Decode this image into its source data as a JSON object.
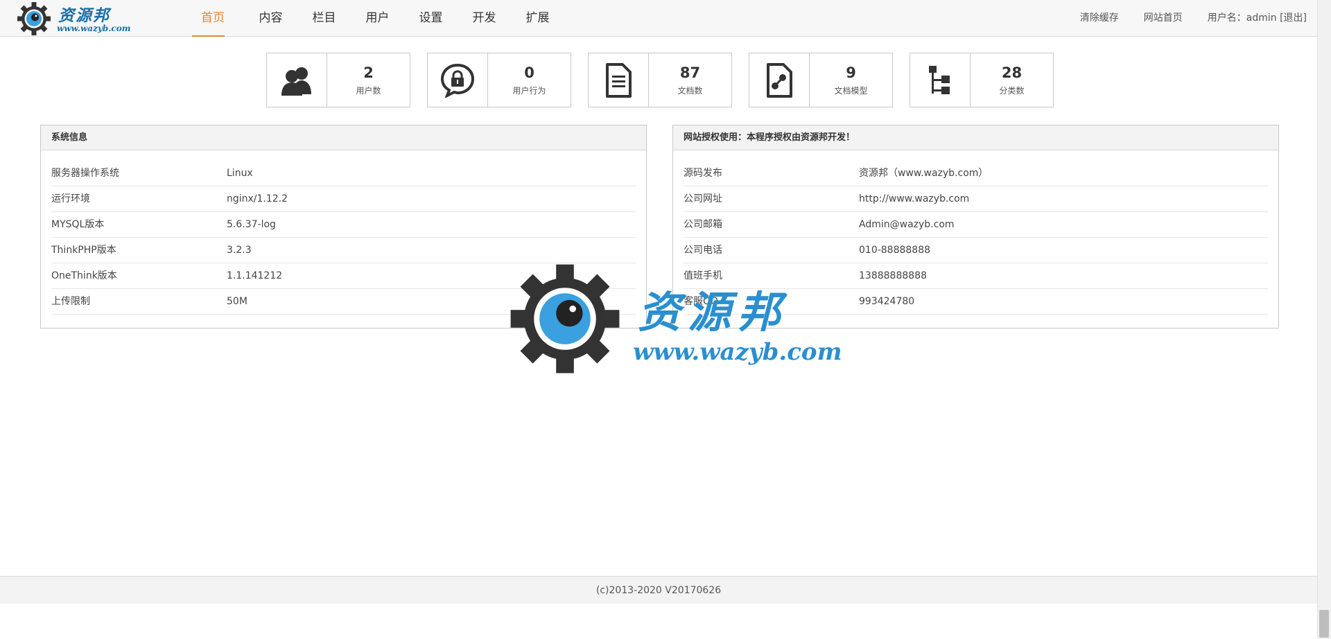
{
  "header": {
    "logo": {
      "title": "资源邦",
      "url": "www.wazyb.com"
    },
    "nav": [
      {
        "label": "首页",
        "active": true
      },
      {
        "label": "内容"
      },
      {
        "label": "栏目"
      },
      {
        "label": "用户"
      },
      {
        "label": "设置"
      },
      {
        "label": "开发"
      },
      {
        "label": "扩展"
      }
    ],
    "right": {
      "clear_cache": "清除缓存",
      "site_home": "网站首页",
      "user_prefix": "用户名：admin",
      "logout": "[退出]"
    }
  },
  "stats": [
    {
      "icon": "users-icon",
      "value": "2",
      "label": "用户数"
    },
    {
      "icon": "lock-chat-icon",
      "value": "0",
      "label": "用户行为"
    },
    {
      "icon": "document-icon",
      "value": "87",
      "label": "文档数"
    },
    {
      "icon": "document-model-icon",
      "value": "9",
      "label": "文档模型"
    },
    {
      "icon": "tree-icon",
      "value": "28",
      "label": "分类数"
    }
  ],
  "system_panel": {
    "title": "系统信息",
    "rows": [
      {
        "k": "服务器操作系统",
        "v": "Linux"
      },
      {
        "k": "运行环境",
        "v": "nginx/1.12.2"
      },
      {
        "k": "MYSQL版本",
        "v": "5.6.37-log"
      },
      {
        "k": "ThinkPHP版本",
        "v": "3.2.3"
      },
      {
        "k": "OneThink版本",
        "v": "1.1.141212"
      },
      {
        "k": "上传限制",
        "v": "50M"
      }
    ]
  },
  "license_panel": {
    "title": "网站授权使用：本程序授权由资源邦开发！",
    "rows": [
      {
        "k": "源码发布",
        "v": "资源邦（www.wazyb.com）"
      },
      {
        "k": "公司网址",
        "v": "http://www.wazyb.com"
      },
      {
        "k": "公司邮箱",
        "v": "Admin@wazyb.com"
      },
      {
        "k": "公司电话",
        "v": "010-88888888"
      },
      {
        "k": "值班手机",
        "v": "13888888888"
      },
      {
        "k": "客服QQ",
        "v": "993424780"
      }
    ]
  },
  "watermark": {
    "title": "资源邦",
    "url": "www.wazyb.com"
  },
  "footer": {
    "copyright": "(c)2013-2020 V20170626"
  },
  "colors": {
    "accent": "#e8862f",
    "brand_blue": "#2a8fd0",
    "gear": "#333333"
  }
}
